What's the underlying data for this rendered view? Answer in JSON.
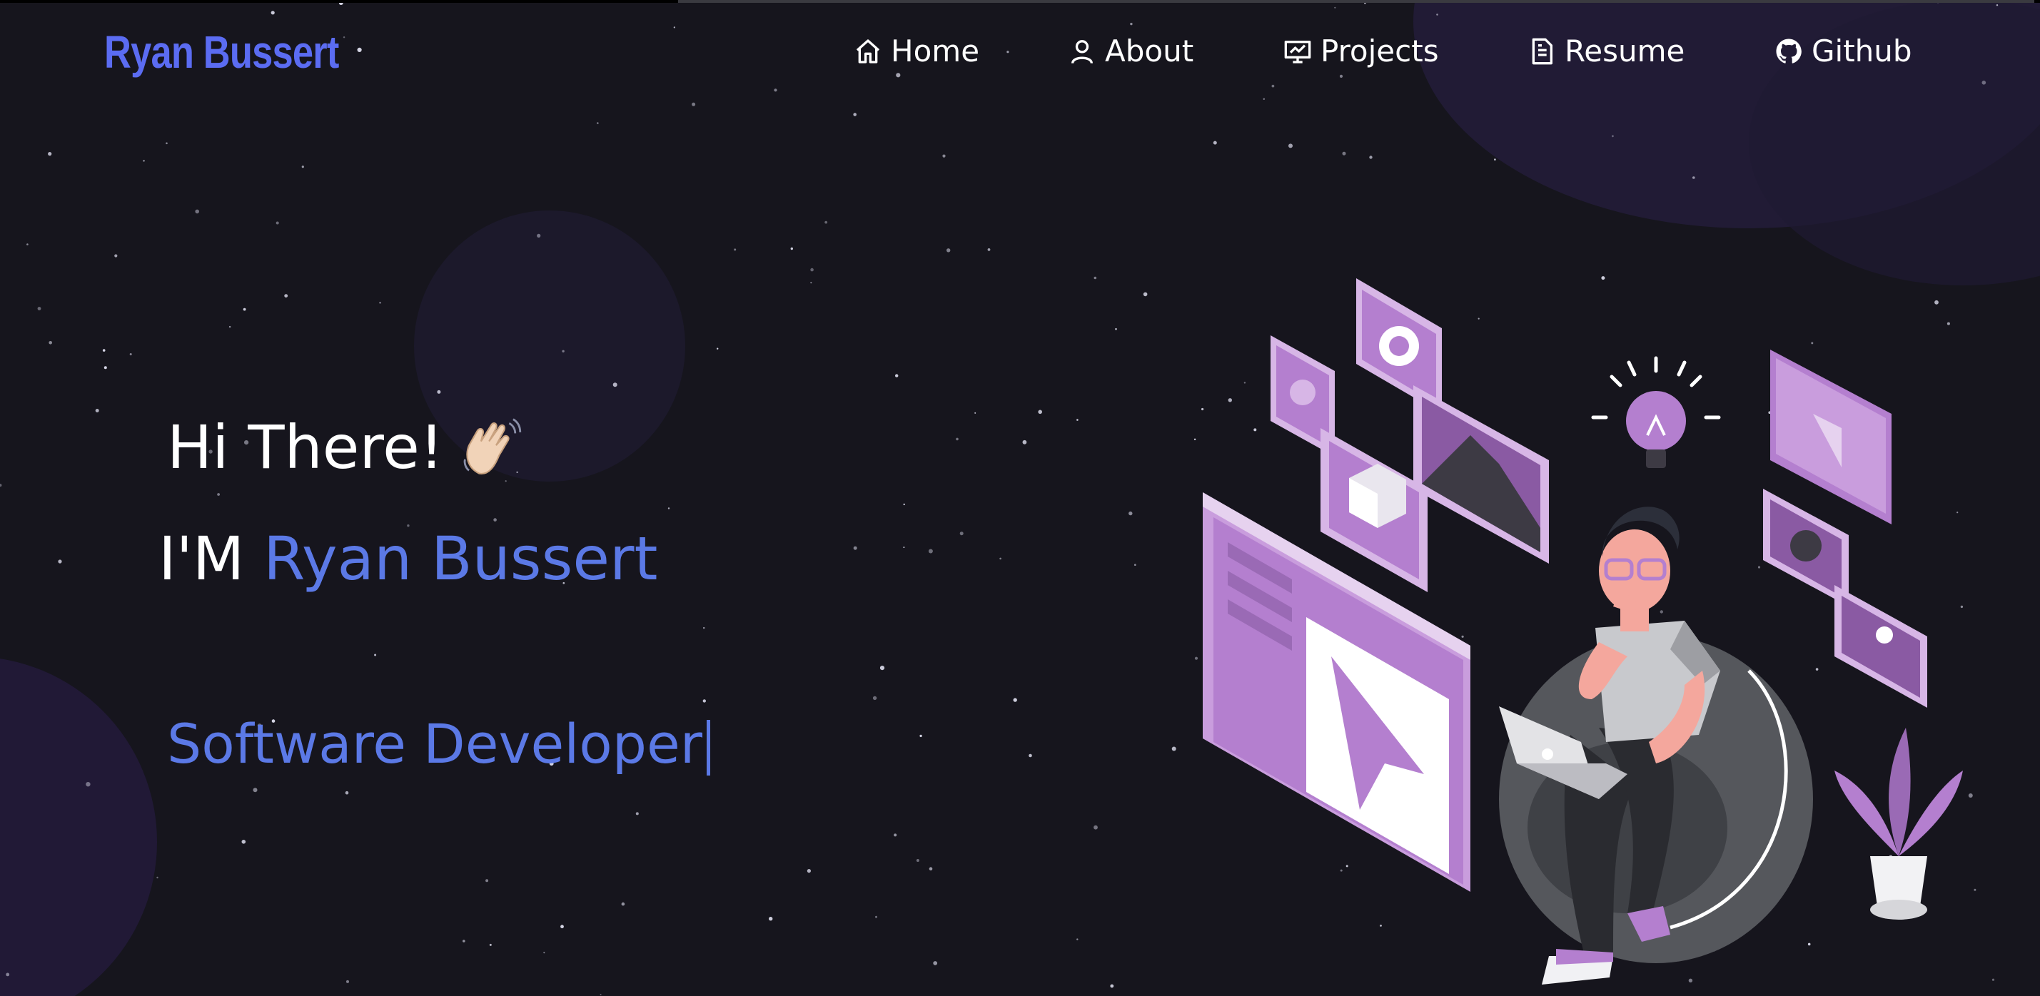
{
  "brand": "Ryan Bussert",
  "nav": [
    {
      "label": "Home",
      "icon": "home-icon"
    },
    {
      "label": "About",
      "icon": "user-icon"
    },
    {
      "label": "Projects",
      "icon": "presentation-chart-icon"
    },
    {
      "label": "Resume",
      "icon": "document-icon"
    },
    {
      "label": "Github",
      "icon": "github-icon"
    }
  ],
  "hero": {
    "greeting": "Hi There!",
    "greeting_emoji": "waving-hand-icon",
    "im_prefix": "I'M",
    "name": "Ryan Bussert",
    "role": "Software Developer"
  },
  "colors": {
    "background": "#16151d",
    "accent": "#5b79e6",
    "brand": "#5b6cf2",
    "purple": "#b47fcf"
  }
}
